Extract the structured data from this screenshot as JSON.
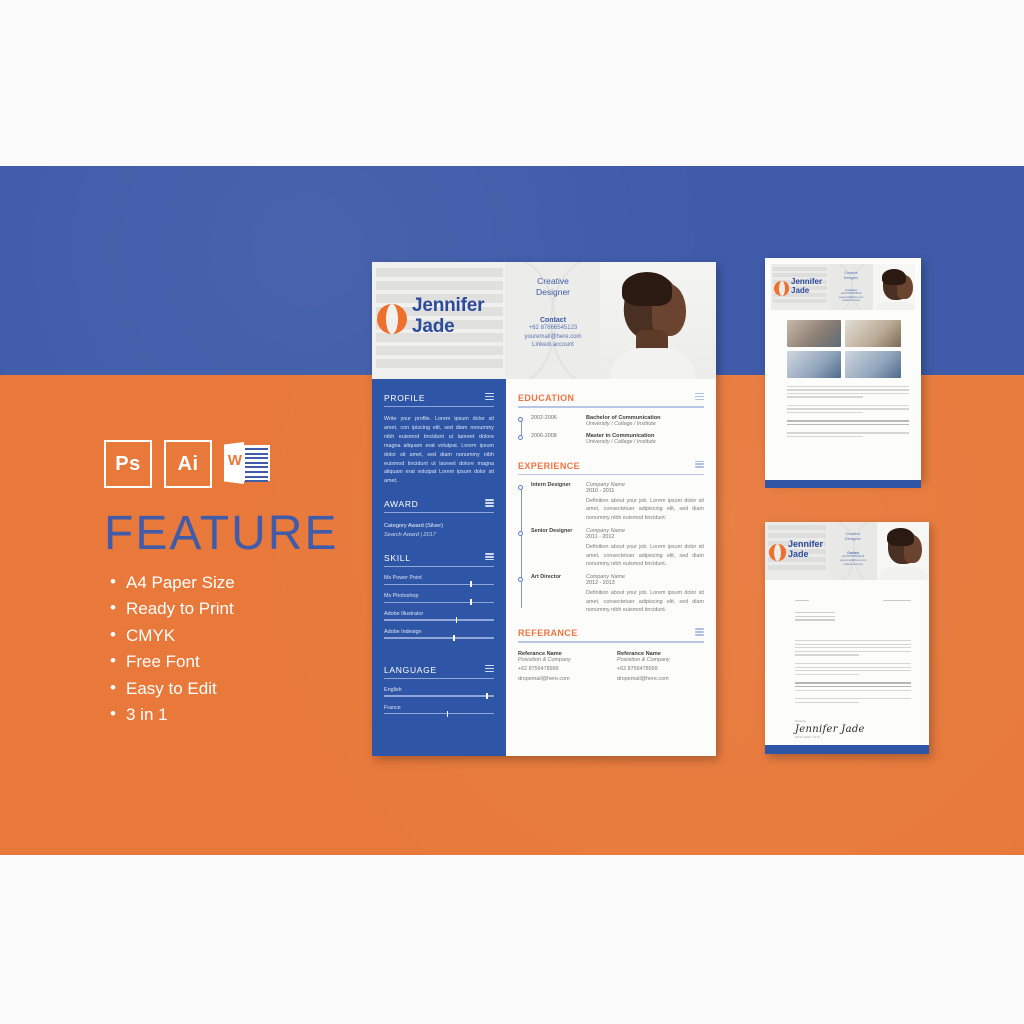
{
  "background": {
    "top_color": "#fbfbfb",
    "blue_band_color": "#3f5ba9",
    "orange_band_color": "#e8793b"
  },
  "feature_panel": {
    "title": "FEATURE",
    "badges": [
      {
        "name": "photoshop-badge",
        "label": "Ps"
      },
      {
        "name": "illustrator-badge",
        "label": "Ai"
      },
      {
        "name": "word-badge",
        "label": "W"
      }
    ],
    "items": [
      "A4 Paper Size",
      "Ready to Print",
      "CMYK",
      "Free Font",
      "Easy to Edit",
      "3 in 1"
    ]
  },
  "resume": {
    "header": {
      "logo_first_name": "Jennifer",
      "logo_last_name": "Jade",
      "role_line1": "Creative",
      "role_line2": "Designer",
      "contact_label": "Contact",
      "contact_phone": "+62 87666545123",
      "contact_email": "youremail@here.com",
      "contact_linked": "Linkedi.account"
    },
    "sidebar": {
      "profile": {
        "title": "PROFILE",
        "text": "Write your profile. Lorem ipsum dolor sit amet, con ipiscing elit, sed diam nonummy nibh euismod tincidunt ut laoreet dolore magna aliquam erat volutpat. Lorem ipsum dolor sit amet, sed diam nonummy nibh euismod tincidunt ut laoreet dolore magna aliquam erat volutpat Lorem ipsum dolor sit amet,."
      },
      "award": {
        "title": "AWARD",
        "line1": "Category Award (Silver)",
        "line2": "Search Award | 2017"
      },
      "skill": {
        "title": "SKILL",
        "items": [
          {
            "name": "Ms Power Point",
            "level": 78
          },
          {
            "name": "Ms Photoshop",
            "level": 78
          },
          {
            "name": "Adobe Illustrator",
            "level": 65
          },
          {
            "name": "Adobe Indesign",
            "level": 63
          }
        ]
      },
      "language": {
        "title": "LANGUAGE",
        "items": [
          {
            "name": "English",
            "level": 93
          },
          {
            "name": "France",
            "level": 57
          }
        ]
      }
    },
    "main": {
      "education": {
        "title": "EDUCATION",
        "entries": [
          {
            "years": "2002-2006",
            "degree": "Bachelor of Communication",
            "school": "University / College / Institute"
          },
          {
            "years": "2006-2008",
            "degree": "Master in Communication",
            "school": "University / College / Institute"
          }
        ]
      },
      "experience": {
        "title": "EXPERIENCE",
        "entries": [
          {
            "role": "Intern Designer",
            "company": "Company Name",
            "years": "2010 - 2011",
            "desc": "Definition about your job. Lorem ipsum dolor sit amet, consectetuer adipiscing elit, sed diam nonummy nibh euismod tincidunt."
          },
          {
            "role": "Senior Designer",
            "company": "Company Name",
            "years": "2011 - 2012",
            "desc": "Definition about your job. Lorem ipsum dolor sit amet, consectetuer adipiscing elit, sed diam nonummy nibh euismod tincidunt.."
          },
          {
            "role": "Art Director",
            "company": "Company Name",
            "years": "2012 - 2013",
            "desc": "Definition about your job. Lorem ipsum dolor sit amet, consectetuer adipiscing elit, sed diam nonummy nibh euismod tincidunt."
          }
        ]
      },
      "reference": {
        "title": "REFERANCE",
        "entries": [
          {
            "name": "Referance Name",
            "position": "Posisition & Company",
            "phone": "+62 8756478999",
            "email": "dropemail@here.com"
          },
          {
            "name": "Referance Name",
            "position": "Posisition & Company",
            "phone": "+62 8756478999",
            "email": "dropemail@here.com"
          }
        ]
      }
    }
  },
  "portfolio": {
    "logo_first_name": "Jennifer",
    "logo_last_name": "Jade",
    "role_line1": "Creative",
    "role_line2": "Designer",
    "contact_label": "Contact",
    "contact_phone": "+62 87666545123",
    "contact_email": "youremail@here.com",
    "contact_linked": "Linkedi.account"
  },
  "cover_letter": {
    "logo_first_name": "Jennifer",
    "logo_last_name": "Jade",
    "role_line1": "Creative",
    "role_line2": "Designer",
    "contact_label": "Contact",
    "contact_phone": "+62 87666545123",
    "contact_email": "youremail@here.com",
    "contact_linked": "Linkedi.account",
    "signature_pre": "Sincerely,",
    "signature": "Jennifer Jade",
    "signature_sub": "DESIGNER 2018"
  }
}
